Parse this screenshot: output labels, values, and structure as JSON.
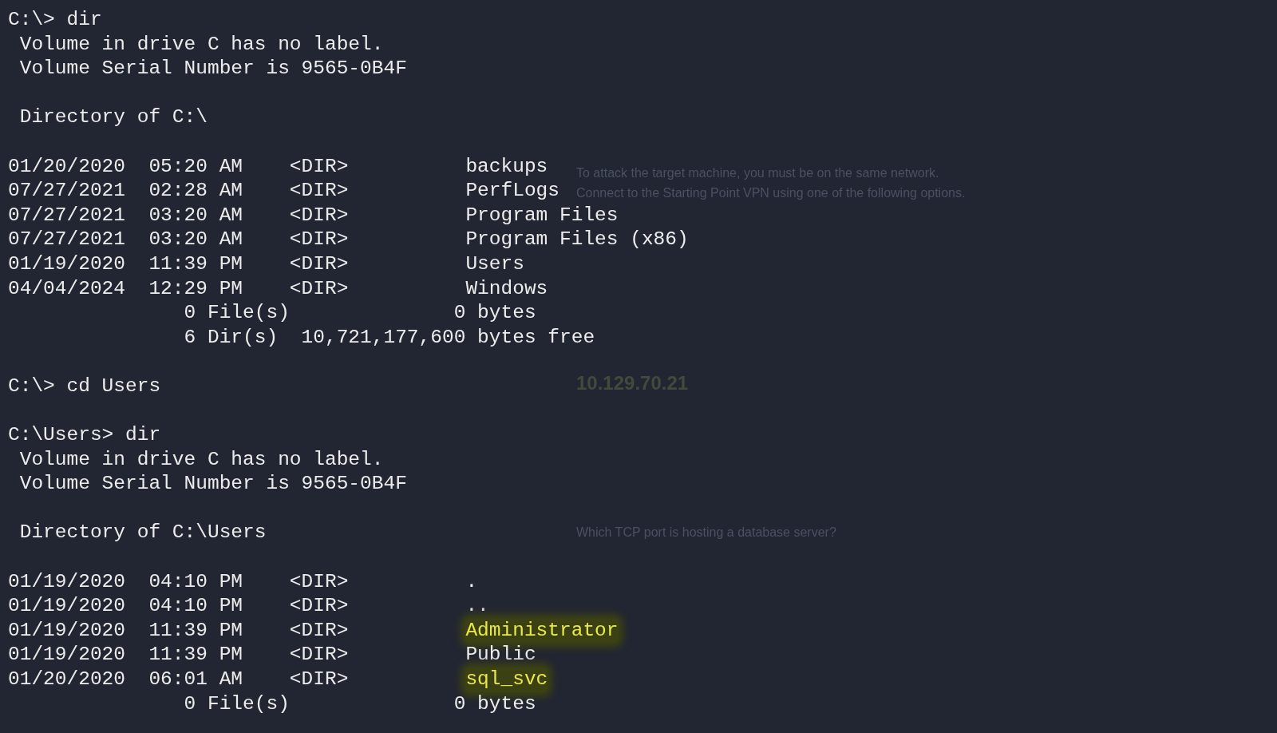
{
  "background_page": {
    "texts": [
      {
        "kind": "body",
        "text": "To attack the target machine, you must be on the same network."
      },
      {
        "kind": "body",
        "text": "Connect to the Starting Point VPN using one of the following options."
      },
      {
        "kind": "ip",
        "text": "10.129.70.21"
      },
      {
        "kind": "question",
        "text": "Which TCP port is hosting a database server?"
      }
    ]
  },
  "terminal": {
    "lines": [
      {
        "kind": "prompt",
        "text": "C:\\> dir"
      },
      {
        "kind": "output",
        "text": "Volume in drive C has no label."
      },
      {
        "kind": "output",
        "text": "Volume Serial Number is 9565-0B4F"
      },
      {
        "kind": "blank"
      },
      {
        "kind": "output",
        "text": "Directory of C:\\"
      },
      {
        "kind": "blank"
      },
      {
        "kind": "entry",
        "date": "01/20/2020",
        "time": "05:20 AM",
        "type": "<DIR>",
        "name": "backups",
        "highlighted": false
      },
      {
        "kind": "entry",
        "date": "07/27/2021",
        "time": "02:28 AM",
        "type": "<DIR>",
        "name": "PerfLogs",
        "highlighted": false
      },
      {
        "kind": "entry",
        "date": "07/27/2021",
        "time": "03:20 AM",
        "type": "<DIR>",
        "name": "Program Files",
        "highlighted": false
      },
      {
        "kind": "entry",
        "date": "07/27/2021",
        "time": "03:20 AM",
        "type": "<DIR>",
        "name": "Program Files (x86)",
        "highlighted": false
      },
      {
        "kind": "entry",
        "date": "01/19/2020",
        "time": "11:39 PM",
        "type": "<DIR>",
        "name": "Users",
        "highlighted": false
      },
      {
        "kind": "entry",
        "date": "04/04/2024",
        "time": "12:29 PM",
        "type": "<DIR>",
        "name": "Windows",
        "highlighted": false
      },
      {
        "kind": "summary",
        "count": "0 File(s)",
        "size": "0 bytes"
      },
      {
        "kind": "summary",
        "count": "6 Dir(s)",
        "size": "10,721,177,600 bytes free"
      },
      {
        "kind": "blank"
      },
      {
        "kind": "prompt",
        "text": "C:\\> cd Users"
      },
      {
        "kind": "blank"
      },
      {
        "kind": "prompt",
        "text": "C:\\Users> dir"
      },
      {
        "kind": "output",
        "text": "Volume in drive C has no label."
      },
      {
        "kind": "output",
        "text": "Volume Serial Number is 9565-0B4F"
      },
      {
        "kind": "blank"
      },
      {
        "kind": "output",
        "text": "Directory of C:\\Users"
      },
      {
        "kind": "blank"
      },
      {
        "kind": "entry",
        "date": "01/19/2020",
        "time": "04:10 PM",
        "type": "<DIR>",
        "name": ".",
        "highlighted": false
      },
      {
        "kind": "entry",
        "date": "01/19/2020",
        "time": "04:10 PM",
        "type": "<DIR>",
        "name": "..",
        "highlighted": false
      },
      {
        "kind": "entry",
        "date": "01/19/2020",
        "time": "11:39 PM",
        "type": "<DIR>",
        "name": "Administrator",
        "highlighted": true
      },
      {
        "kind": "entry",
        "date": "01/19/2020",
        "time": "11:39 PM",
        "type": "<DIR>",
        "name": "Public",
        "highlighted": false
      },
      {
        "kind": "entry",
        "date": "01/20/2020",
        "time": "06:01 AM",
        "type": "<DIR>",
        "name": "sql_svc",
        "highlighted": true
      },
      {
        "kind": "summary",
        "count": "0 File(s)",
        "size": "0 bytes"
      }
    ]
  }
}
